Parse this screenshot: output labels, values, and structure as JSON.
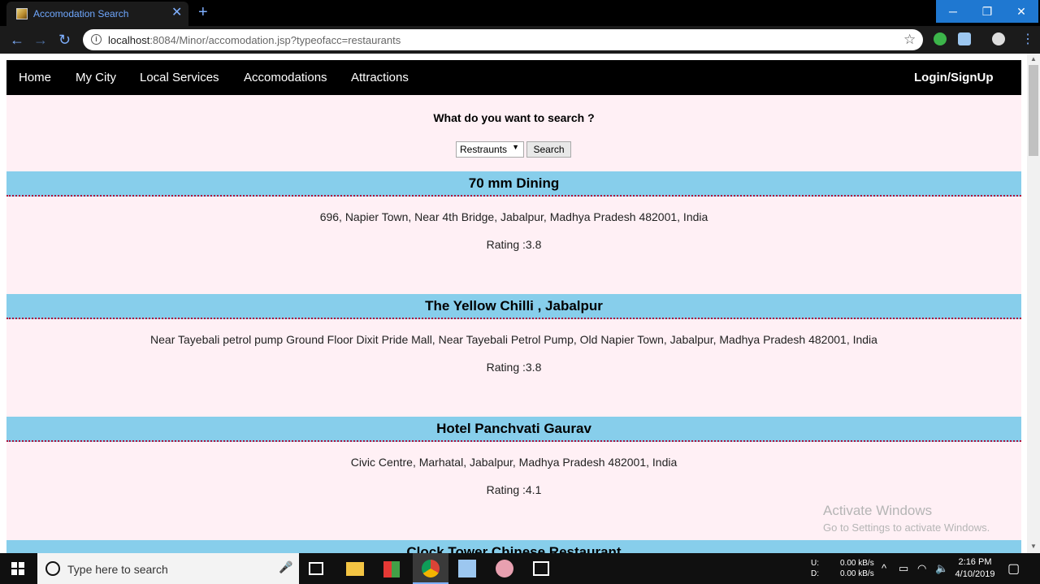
{
  "browser": {
    "tab_title": "Accomodation Search",
    "tab_close": "✕",
    "new_tab": "+",
    "url_host": "localhost",
    "url_rest": ":8084/Minor/accomodation.jsp?typeofacc=restaurants",
    "minimize": "─",
    "maximize": "❐",
    "close": "✕"
  },
  "nav": {
    "items": [
      {
        "label": "Home"
      },
      {
        "label": "My City"
      },
      {
        "label": "Local Services"
      },
      {
        "label": "Accomodations"
      },
      {
        "label": "Attractions"
      }
    ],
    "login": "Login/SignUp"
  },
  "search": {
    "heading": "What do you want to search ?",
    "selected": "Restraunts",
    "button": "Search"
  },
  "results": [
    {
      "name": "70 mm Dining",
      "address": "696, Napier Town, Near 4th Bridge, Jabalpur, Madhya Pradesh 482001, India",
      "rating": "Rating :3.8"
    },
    {
      "name": "The Yellow Chilli , Jabalpur",
      "address": "Near Tayebali petrol pump Ground Floor Dixit Pride Mall, Near Tayebali Petrol Pump, Old Napier Town, Jabalpur, Madhya Pradesh 482001, India",
      "rating": "Rating :3.8"
    },
    {
      "name": "Hotel Panchvati Gaurav",
      "address": "Civic Centre, Marhatal, Jabalpur, Madhya Pradesh 482001, India",
      "rating": "Rating :4.1"
    },
    {
      "name": "Clock Tower Chinese Restaurant",
      "address": "",
      "rating": ""
    }
  ],
  "watermark": {
    "title": "Activate Windows",
    "subtitle": "Go to Settings to activate Windows."
  },
  "taskbar": {
    "search_placeholder": "Type here to search",
    "net_u_label": "U:",
    "net_d_label": "D:",
    "net_u": "0.00 kB/s",
    "net_d": "0.00 kB/s",
    "time": "2:16 PM",
    "date": "4/10/2019"
  },
  "colors": {
    "page_bg": "#fff0f5",
    "navbar_bg": "#000000",
    "result_header_bg": "#87ceeb",
    "result_border": "#b0103a"
  }
}
